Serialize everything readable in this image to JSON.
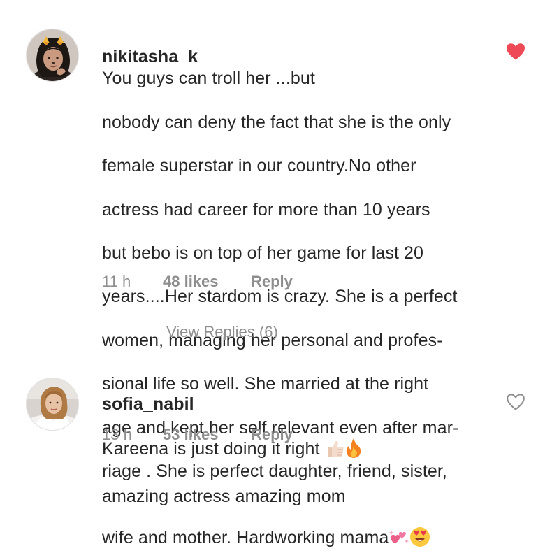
{
  "comments": [
    {
      "username": "nikitasha_k_",
      "lines": [
        "You guys can troll her ...but",
        "nobody can deny the fact that she is the only",
        "female superstar in our country.No other",
        "actress had career for more than 10 years",
        "but bebo is on top of her game for last 20",
        "years....Her stardom is crazy. She is a perfect",
        "women, managing her personal and profes-",
        "sional life so well. She married at the right",
        "age and kept her self relevant even after mar-",
        "riage . She is perfect daughter, friend, sister,",
        "wife and mother.  Hardworking mama"
      ],
      "trailing_emojis": [
        "sparkling-hearts-emoji",
        "heart-eyes-emoji"
      ],
      "time": "11 h",
      "likes": "48 likes",
      "reply_label": "Reply",
      "liked": true,
      "like_color": "#ed4956"
    },
    {
      "username": "sofia_nabil",
      "lines": [
        "Kareena is just doing it right",
        "amazing actress amazing mom"
      ],
      "trailing_emojis": [
        "thumbs-up-emoji",
        "fire-emoji"
      ],
      "time": "13 h",
      "likes": "53 likes",
      "reply_label": "Reply",
      "liked": false,
      "like_color": "#8e8e8e"
    }
  ],
  "view_replies": {
    "label": "View Replies (6)"
  }
}
